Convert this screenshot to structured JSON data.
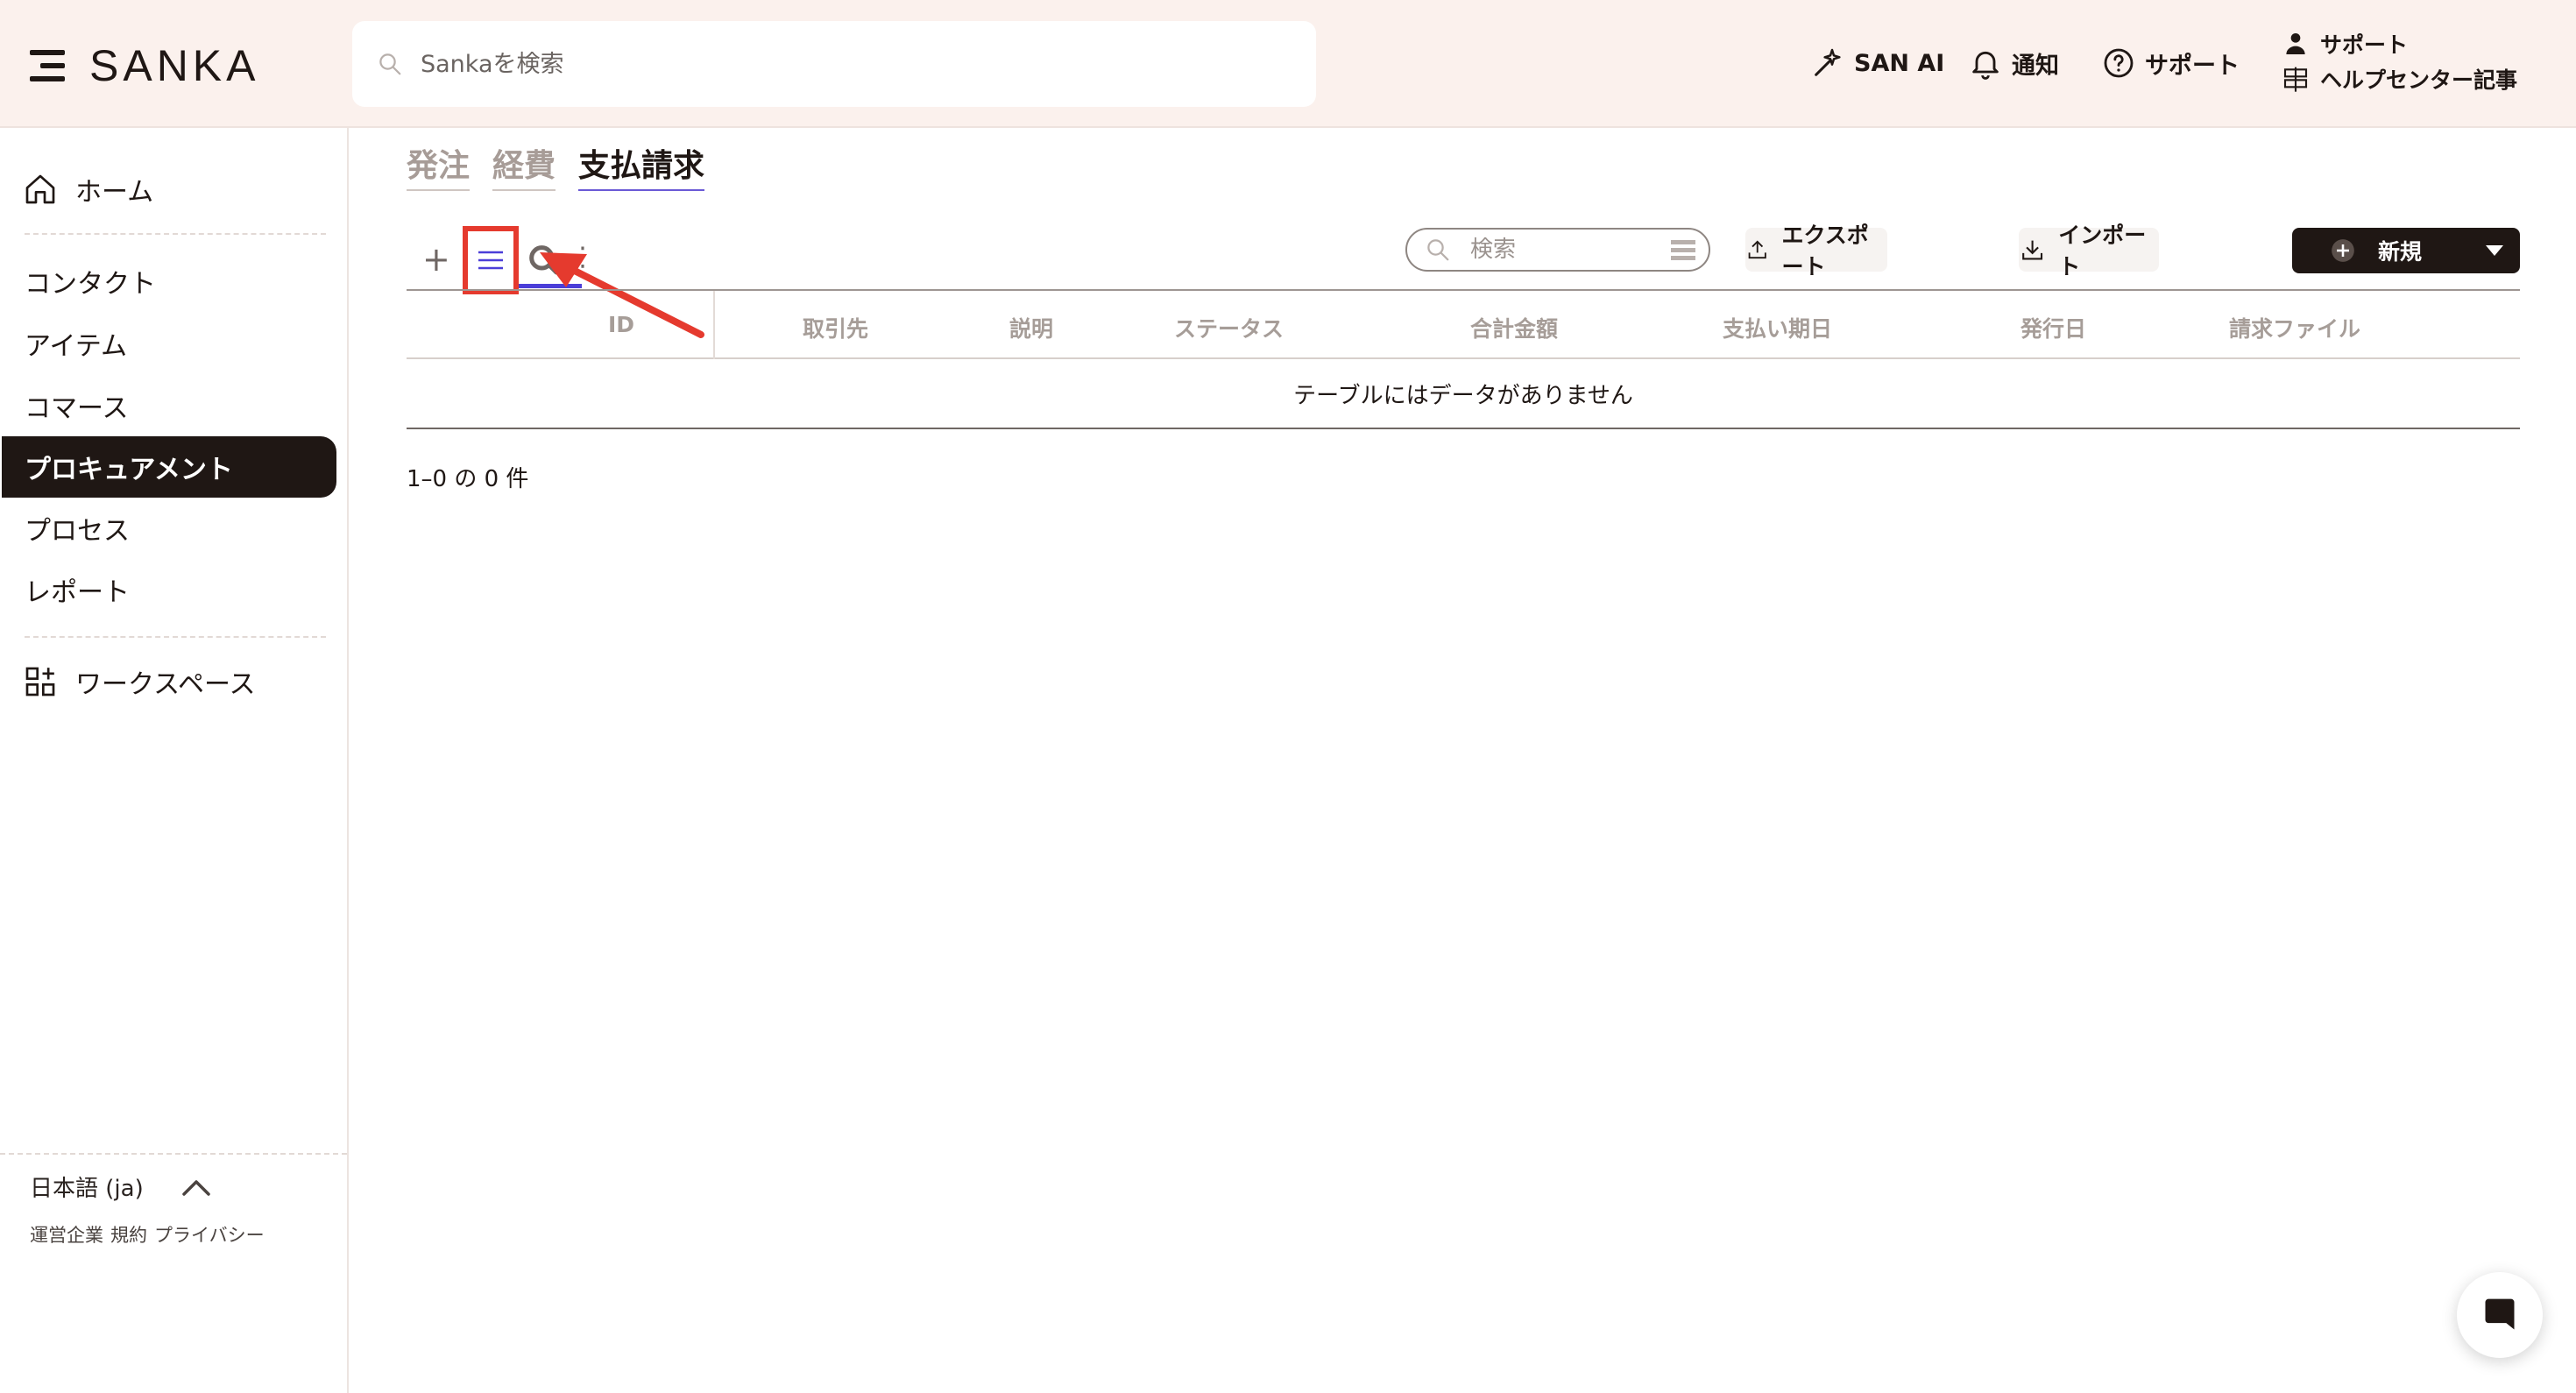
{
  "brand": {
    "name": "SANKA"
  },
  "header": {
    "search_placeholder": "Sankaを検索",
    "actions": {
      "san_ai": "SAN AI",
      "notifications": "通知",
      "support": "サポート"
    },
    "help": {
      "support": "サポート",
      "help_center": "ヘルプセンター記事"
    }
  },
  "sidebar": {
    "home": "ホーム",
    "items": [
      "コンタクト",
      "アイテム",
      "コマース",
      "プロキュアメント",
      "プロセス",
      "レポート"
    ],
    "active_index": 3,
    "workspace": "ワークスペース",
    "language": "日本語 (ja)",
    "footer_links": [
      "運営企業",
      "規約",
      "プライバシー"
    ]
  },
  "main": {
    "tabs": [
      "発注",
      "経費",
      "支払請求"
    ],
    "active_tab": "支払請求",
    "toolbar": {
      "plus": "+",
      "more": "⋮",
      "search_placeholder": "検索",
      "export": "エクスポート",
      "import": "インポート",
      "new": "新規"
    },
    "table": {
      "columns": [
        "ID",
        "取引先",
        "説明",
        "ステータス",
        "合計金額",
        "支払い期日",
        "発行日",
        "請求ファイル"
      ],
      "empty_message": "テーブルにはデータがありません"
    },
    "pagination": "1–0 の 0 件"
  },
  "colors": {
    "topbar_bg": "#fbf1ed",
    "brand_dark": "#1f1714",
    "accent": "#4b3ed8",
    "annotation_red": "#e53a2e"
  }
}
